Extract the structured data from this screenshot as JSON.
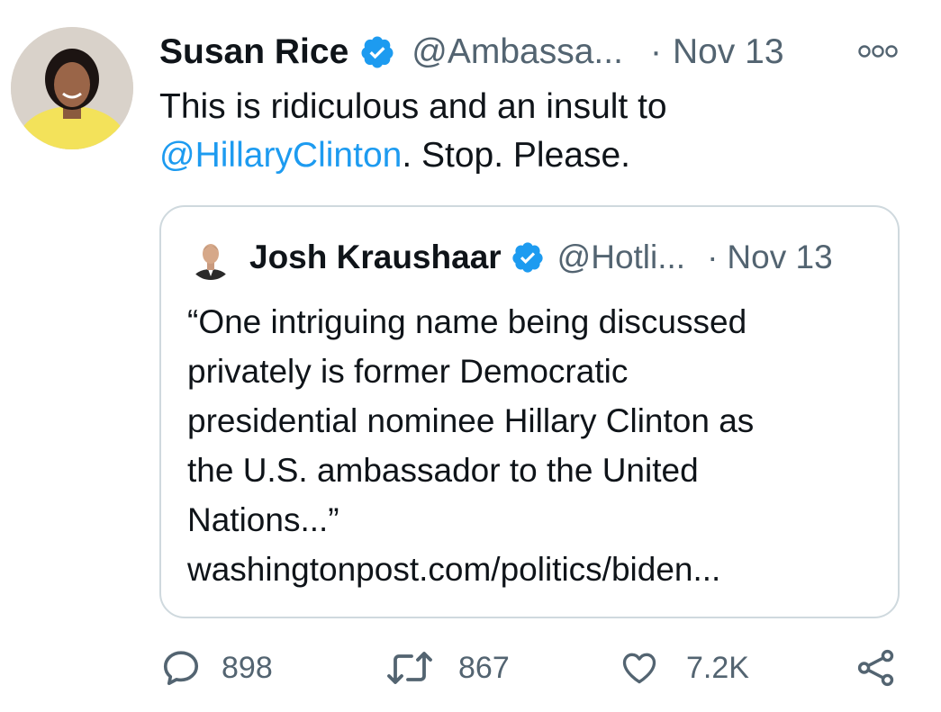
{
  "tweet": {
    "author_name": "Susan Rice",
    "handle": "@Ambassa...",
    "separator": "·",
    "time": "Nov 13",
    "text_line1": "This is ridiculous and an insult to",
    "mention": "@HillaryClinton",
    "text_after_mention": ". Stop. Please."
  },
  "quote": {
    "author_name": "Josh Kraushaar",
    "handle": "@Hotli...",
    "separator": "·",
    "time": "Nov 13",
    "lines": [
      "“One intriguing name being discussed",
      "privately is former Democratic",
      "presidential nominee Hillary Clinton as",
      "the U.S. ambassador to the United",
      "Nations...”",
      "washingtonpost.com/politics/biden..."
    ]
  },
  "actions": {
    "replies": "898",
    "retweets": "867",
    "likes": "7.2K"
  },
  "icons": {
    "verified": "verified-badge-icon",
    "more": "more-icon",
    "reply": "reply-icon",
    "retweet": "retweet-icon",
    "like": "heart-icon",
    "share": "share-icon"
  },
  "colors": {
    "text": "#0f1419",
    "secondary": "#536471",
    "link": "#1d9bf0",
    "verified": "#1d9bf0",
    "border": "#cfd9de"
  }
}
